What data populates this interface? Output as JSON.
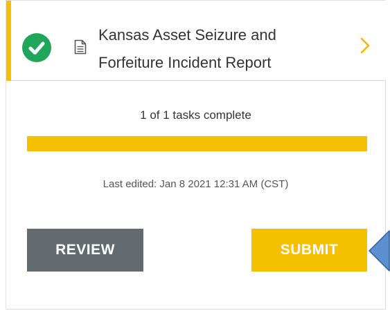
{
  "task": {
    "title": "Kansas Asset Seizure and Forfeiture Incident Report",
    "status_icon": "check-circle-icon",
    "type_icon": "document-icon",
    "open_icon": "chevron-right-icon"
  },
  "progress": {
    "text": "1 of 1 tasks complete",
    "completed": 1,
    "total": 1,
    "fraction": 1.0
  },
  "last_edited": "Last edited: Jan 8 2021 12:31 AM (CST)",
  "buttons": {
    "review_label": "REVIEW",
    "submit_label": "SUBMIT"
  },
  "colors": {
    "accent": "#f5c000",
    "success": "#1fa65a",
    "review_button": "#636b70",
    "pointer": "#5b8fcf"
  }
}
